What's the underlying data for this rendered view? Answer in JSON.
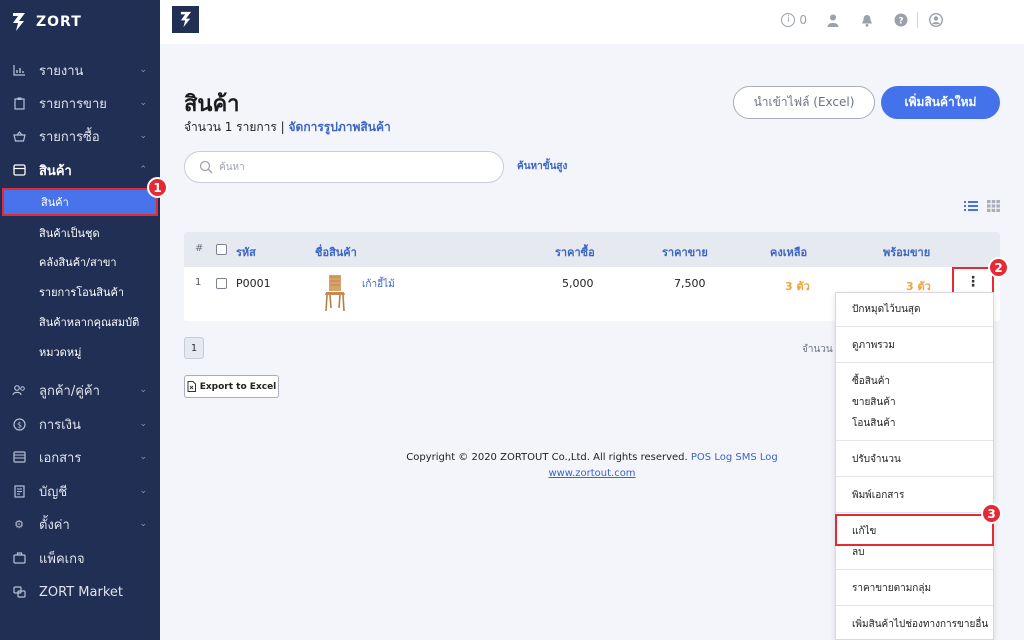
{
  "app": {
    "brand": "ZORT"
  },
  "topbar": {
    "info_count": "0"
  },
  "sidebar": {
    "items": [
      {
        "label": "รายงาน",
        "icon": "chart-icon"
      },
      {
        "label": "รายการขาย",
        "icon": "clipboard-icon"
      },
      {
        "label": "รายการซื้อ",
        "icon": "basket-icon"
      },
      {
        "label": "สินค้า",
        "icon": "box-icon"
      },
      {
        "label": "ลูกค้า/คู่ค้า",
        "icon": "users-icon"
      },
      {
        "label": "การเงิน",
        "icon": "dollar-icon"
      },
      {
        "label": "เอกสาร",
        "icon": "document-icon"
      },
      {
        "label": "บัญชี",
        "icon": "ledger-icon"
      },
      {
        "label": "ตั้งค่า",
        "icon": "gear-icon"
      },
      {
        "label": "แพ็คเกจ",
        "icon": "package-icon"
      },
      {
        "label": "ZORT Market",
        "icon": "market-icon"
      }
    ],
    "product_sub": [
      "สินค้า",
      "สินค้าเป็นชุด",
      "คลังสินค้า/สาขา",
      "รายการโอนสินค้า",
      "สินค้าหลากคุณสมบัติ",
      "หมวดหมู่"
    ]
  },
  "page": {
    "title": "สินค้า",
    "count_text": "จำนวน 1 รายการ | ",
    "manage_images": "จัดการรูปภาพสินค้า",
    "import_button": "นำเข้าไฟล์ (Excel)",
    "new_button": "เพิ่มสินค้าใหม่",
    "search_placeholder": "ค้นหา",
    "advanced_search": "ค้นหาขั้นสูง"
  },
  "table": {
    "headers": {
      "index": "#",
      "code": "รหัส",
      "name": "ชื่อสินค้า",
      "buy_price": "ราคาซื้อ",
      "sell_price": "ราคาขาย",
      "remaining": "คงเหลือ",
      "ready": "พร้อมขาย"
    },
    "rows": [
      {
        "index": "1",
        "code": "P0001",
        "name": "เก้าอี้ไม้",
        "buy_price": "5,000",
        "sell_price": "7,500",
        "remaining": "3 ตัว",
        "ready": "3 ตัว"
      }
    ]
  },
  "pagination": {
    "page": "1",
    "qty_label": "จำนวน"
  },
  "export_button": "Export to Excel",
  "footer": {
    "copyright": "Copyright © 2020 ZORTOUT Co.,Ltd. All rights reserved.",
    "links": [
      "POS",
      "Log",
      "SMS Log"
    ],
    "website": "www.zortout.com"
  },
  "menu": {
    "items": [
      "ปักหมุดไว้บนสุด",
      "ดูภาพรวม",
      "ซื้อสินค้า",
      "ขายสินค้า",
      "โอนสินค้า",
      "ปรับจำนวน",
      "พิมพ์เอกสาร",
      "แก้ไข",
      "ลบ",
      "ราคาขายตามกลุ่ม",
      "เพิ่มสินค้าไปช่องทางการขายอื่น"
    ]
  },
  "badges": [
    "1",
    "2",
    "3"
  ],
  "colors": {
    "sidebar": "#222f54",
    "accent": "#4472ea",
    "highlight": "#e52a36",
    "stock": "#f0a43f"
  }
}
